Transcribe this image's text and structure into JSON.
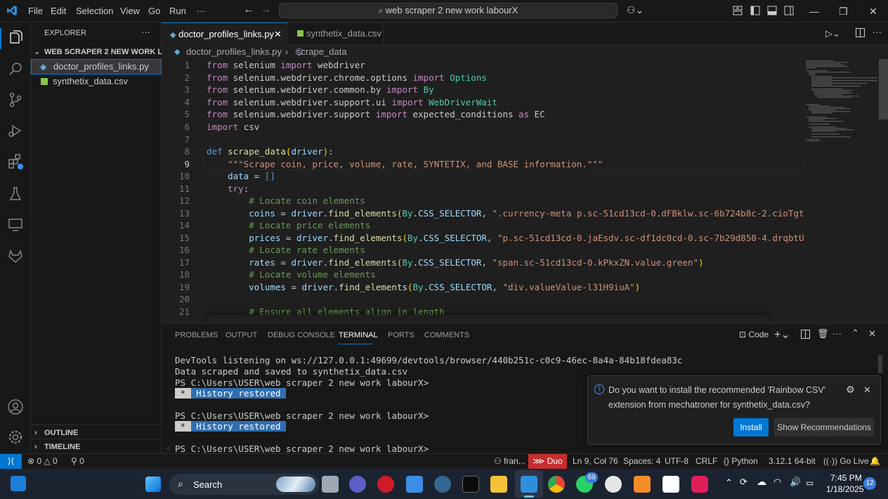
{
  "titlebar": {
    "menus": [
      "File",
      "Edit",
      "Selection",
      "View",
      "Go",
      "Run",
      "···"
    ],
    "search": "web scraper 2 new work labourX"
  },
  "sidebar": {
    "header": "EXPLORER",
    "more": "···",
    "folder": "WEB SCRAPER 2 NEW WORK LA...",
    "files": [
      {
        "name": "doctor_profiles_links.py",
        "icon": "python-icon"
      },
      {
        "name": "synthetix_data.csv",
        "icon": "csv-icon"
      }
    ],
    "outline": "OUTLINE",
    "timeline": "TIMELINE"
  },
  "tabs": [
    {
      "label": "doctor_profiles_links.py",
      "active": true
    },
    {
      "label": "synthetix_data.csv",
      "active": false
    }
  ],
  "breadcrumb": {
    "file": "doctor_profiles_links.py",
    "symbol": "scrape_data"
  },
  "code": {
    "line_numbers": [
      "1",
      "2",
      "3",
      "4",
      "5",
      "6",
      "7",
      "8",
      "9",
      "10",
      "11",
      "12",
      "13",
      "14",
      "15",
      "16",
      "17",
      "18",
      "19",
      "20",
      "21"
    ],
    "active_line": "9"
  },
  "panel": {
    "tabs": [
      "PROBLEMS",
      "OUTPUT",
      "DEBUG CONSOLE",
      "TERMINAL",
      "PORTS",
      "COMMENTS"
    ],
    "active_tab": "TERMINAL",
    "shell": "Code",
    "terminal_lines": [
      "DevTools listening on ws://127.0.0.1:49699/devtools/browser/440b251c-c0c9-46ec-8a4a-84b18fdea83c",
      "Data scraped and saved to synthetix_data.csv",
      "PS C:\\Users\\USER\\web scraper 2 new work labourX>",
      "PS C:\\Users\\USER\\web scraper 2 new work labourX>",
      "PS C:\\Users\\USER\\web scraper 2 new work labourX>"
    ],
    "history_label": "History restored",
    "history_marker": "*"
  },
  "notification": {
    "line1": "Do you want to install the recommended 'Rainbow CSV'",
    "line2": "extension from mechatroner for synthetix_data.csv?",
    "install": "Install",
    "show": "Show Recommendations"
  },
  "status": {
    "remote": "⟩⟨",
    "errors": "0",
    "warnings": "0",
    "ports": "0",
    "user": "fran...",
    "duo": "Duo",
    "position": "Ln 9, Col 76",
    "spaces": "Spaces: 4",
    "encoding": "UTF-8",
    "eol": "CRLF",
    "language": "Python",
    "interpreter": "3.12.1 64-bit",
    "golive": "Go Live"
  },
  "taskbar": {
    "search": "Search",
    "time": "7:45 PM",
    "date": "1/18/2025",
    "badge_whatsapp": "69",
    "badge_notif": "12"
  },
  "colors": {
    "accent": "#0078d4",
    "duo": "#c72e2e",
    "history": "#2f6fb0"
  }
}
